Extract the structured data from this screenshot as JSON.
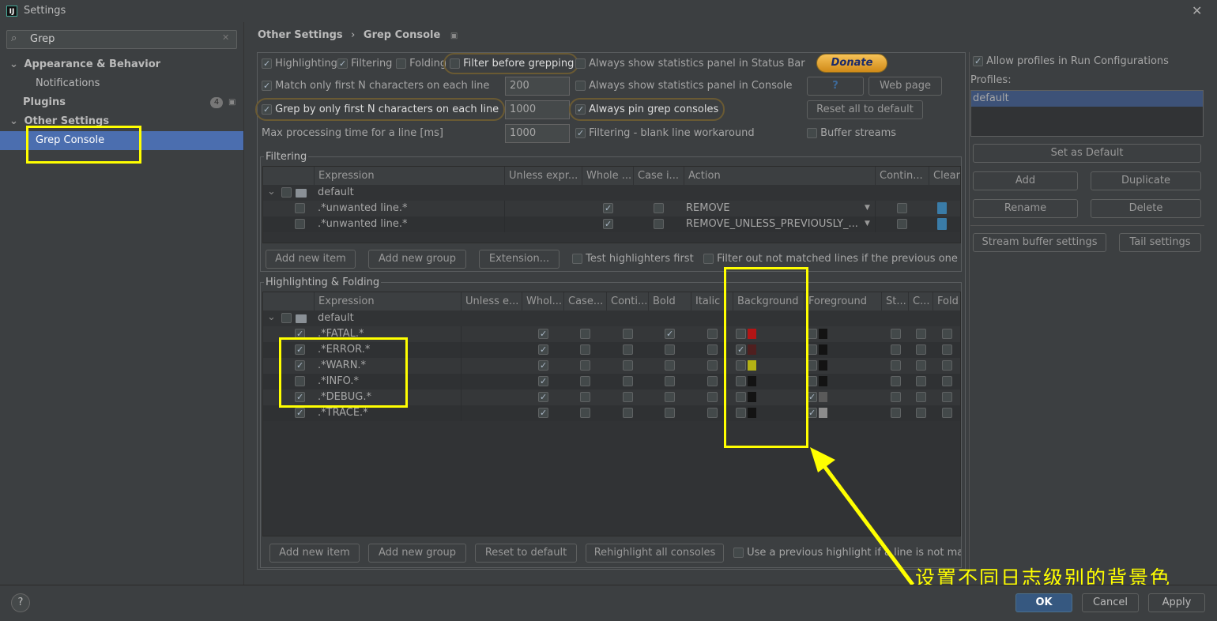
{
  "window": {
    "title": "Settings",
    "close_icon": "close-icon",
    "app_icon": "intellij-icon",
    "app_icon_text": "IJ"
  },
  "sidebar": {
    "search_value": "Grep",
    "items": [
      {
        "label": "Appearance & Behavior",
        "expanded": true
      },
      {
        "label": "Notifications"
      },
      {
        "label": "Plugins",
        "badge": "4"
      },
      {
        "label": "Other Settings",
        "expanded": true
      },
      {
        "label": "Grep Console",
        "selected": true
      }
    ]
  },
  "breadcrumb": {
    "parent": "Other Settings",
    "sep": "›",
    "current": "Grep Console"
  },
  "options": {
    "highlighting": {
      "label": "Highlighting",
      "checked": true
    },
    "filtering": {
      "label": "Filtering",
      "checked": true
    },
    "folding": {
      "label": "Folding",
      "checked": false
    },
    "filter_before": {
      "label": "Filter before grepping",
      "checked": false
    },
    "stats_status": {
      "label": "Always show statistics panel in Status Bar",
      "checked": false
    },
    "match_first": {
      "label": "Match only first N characters on each line",
      "checked": true,
      "value": "200"
    },
    "stats_console": {
      "label": "Always show statistics panel in Console",
      "checked": false
    },
    "grep_first": {
      "label": "Grep by only first N characters on each line",
      "checked": true,
      "value": "1000"
    },
    "pin": {
      "label": "Always pin grep consoles",
      "checked": true
    },
    "max_time": {
      "label": "Max processing time for a line [ms]",
      "value": "1000"
    },
    "blank_line": {
      "label": "Filtering - blank line workaround",
      "checked": true
    },
    "buffer": {
      "label": "Buffer streams",
      "checked": false
    },
    "donate": "Donate",
    "help": "?",
    "web_page": "Web page",
    "reset_all": "Reset all to default"
  },
  "filtering": {
    "title": "Filtering",
    "columns": [
      "",
      "Expression",
      "Unless expr...",
      "Whole ...",
      "Case i...",
      "Action",
      "Contin...",
      "Clear"
    ],
    "group": "default",
    "rows": [
      {
        "enabled": false,
        "expression": ".*unwanted line.*",
        "whole": true,
        "case": false,
        "action": "REMOVE",
        "continue": false
      },
      {
        "enabled": false,
        "expression": ".*unwanted line.*",
        "whole": true,
        "case": false,
        "action": "REMOVE_UNLESS_PREVIOUSLY_...",
        "continue": false
      }
    ],
    "add_item": "Add new item",
    "add_group": "Add new group",
    "extension": "Extension...",
    "test_first": {
      "label": "Test highlighters first",
      "checked": false
    },
    "filter_out": {
      "label": "Filter out not matched lines if the previous one w",
      "checked": false
    }
  },
  "highlighting": {
    "title": "Highlighting & Folding",
    "columns": [
      "",
      "Expression",
      "Unless e...",
      "Whol...",
      "Case...",
      "Conti...",
      "Bold",
      "Italic",
      "Background",
      "Foreground",
      "St...",
      "C...",
      "Fold"
    ],
    "group": "default",
    "rows": [
      {
        "enabled": true,
        "expression": ".*FATAL.*",
        "whole": true,
        "bold": true,
        "bg_on": false,
        "bg": "#b31515",
        "fg_on": false,
        "fg": "#131313"
      },
      {
        "enabled": true,
        "expression": ".*ERROR.*",
        "whole": true,
        "bold": false,
        "bg_on": true,
        "bg": "#4f1f1f",
        "fg_on": false,
        "fg": "#131313"
      },
      {
        "enabled": true,
        "expression": ".*WARN.*",
        "whole": true,
        "bold": false,
        "bg_on": false,
        "bg": "#b4b214",
        "fg_on": false,
        "fg": "#131313"
      },
      {
        "enabled": false,
        "expression": ".*INFO.*",
        "whole": true,
        "bold": false,
        "bg_on": false,
        "bg": "#131313",
        "fg_on": false,
        "fg": "#131313"
      },
      {
        "enabled": true,
        "expression": ".*DEBUG.*",
        "whole": true,
        "bold": false,
        "bg_on": false,
        "bg": "#131313",
        "fg_on": true,
        "fg": "#5a5a5a"
      },
      {
        "enabled": true,
        "expression": ".*TRACE.*",
        "whole": true,
        "bold": false,
        "bg_on": false,
        "bg": "#131313",
        "fg_on": true,
        "fg": "#8c8c8c"
      }
    ],
    "add_item": "Add new item",
    "add_group": "Add new group",
    "reset": "Reset to default",
    "rehighlight": "Rehighlight all consoles",
    "use_previous": {
      "label": "Use a previous highlight if a line is not mat",
      "checked": false
    }
  },
  "profiles": {
    "allow": {
      "label": "Allow profiles in Run Configurations",
      "checked": true
    },
    "label": "Profiles:",
    "items": [
      "default"
    ],
    "set_default": "Set as Default",
    "add": "Add",
    "duplicate": "Duplicate",
    "rename": "Rename",
    "delete": "Delete",
    "stream_buffer": "Stream buffer settings",
    "tail": "Tail settings"
  },
  "annotation": {
    "text": "设置不同日志级别的背景色",
    "color": "#ffff00"
  },
  "footer": {
    "help": "?",
    "ok": "OK",
    "cancel": "Cancel",
    "apply": "Apply"
  }
}
